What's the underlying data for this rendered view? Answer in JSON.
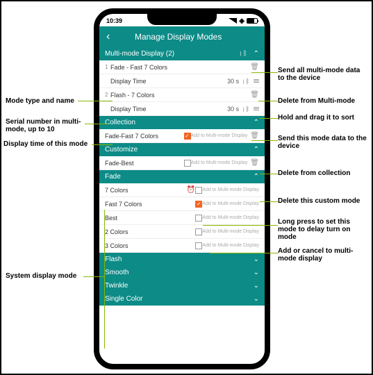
{
  "status": {
    "time": "10:39"
  },
  "header": {
    "title": "Manage Display Modes"
  },
  "multiMode": {
    "title": "Multi-mode Display (2)",
    "items": [
      {
        "serial": "1",
        "name": "Fade - Fast 7 Colors",
        "timeLabel": "Display Time",
        "timeVal": "30 s"
      },
      {
        "serial": "2",
        "name": "Flash - 7 Colors",
        "timeLabel": "Display Time",
        "timeVal": "30 s"
      }
    ]
  },
  "collection": {
    "title": "Collection",
    "items": [
      {
        "name": "Fade-Fast 7 Colors",
        "checked": true,
        "addLabel": "Add to Multi-mode Display"
      }
    ]
  },
  "customize": {
    "title": "Customize",
    "items": [
      {
        "name": "Fade-Best",
        "checked": false,
        "addLabel": "Add to Multi-mode Display"
      }
    ]
  },
  "fade": {
    "title": "Fade",
    "items": [
      {
        "name": "7 Colors",
        "timer": true,
        "addLabel": "Add to Multi-mode Display"
      },
      {
        "name": "Fast 7 Colors",
        "checked": true,
        "addLabel": "Add to Multi-mode Display"
      },
      {
        "name": "Best",
        "checked": false,
        "addLabel": "Add to Multi-mode Display"
      },
      {
        "name": "2 Colors",
        "checked": false,
        "addLabel": "Add to Multi-mode Display"
      },
      {
        "name": "3 Colors",
        "checked": false,
        "addLabel": "Add to Multi-mode Display"
      }
    ]
  },
  "flash": {
    "title": "Flash"
  },
  "smooth": {
    "title": "Smooth"
  },
  "twinkle": {
    "title": "Twinkle"
  },
  "single": {
    "title": "Single Color"
  },
  "annotations": {
    "l1": "Mode type and name",
    "l2": "Serial number in multi-mode, up to 10",
    "l3": "Display time of this mode",
    "l4": "System display mode",
    "r1": "Send all multi-mode data to the device",
    "r2": "Delete from Multi-mode",
    "r3": "Hold and drag it to sort",
    "r4": "Send this mode data to the device",
    "r5": "Delete from collection",
    "r6": "Delete this custom mode",
    "r7": "Long press to set this mode to delay turn on mode",
    "r8": "Add or cancel to multi-mode display"
  }
}
